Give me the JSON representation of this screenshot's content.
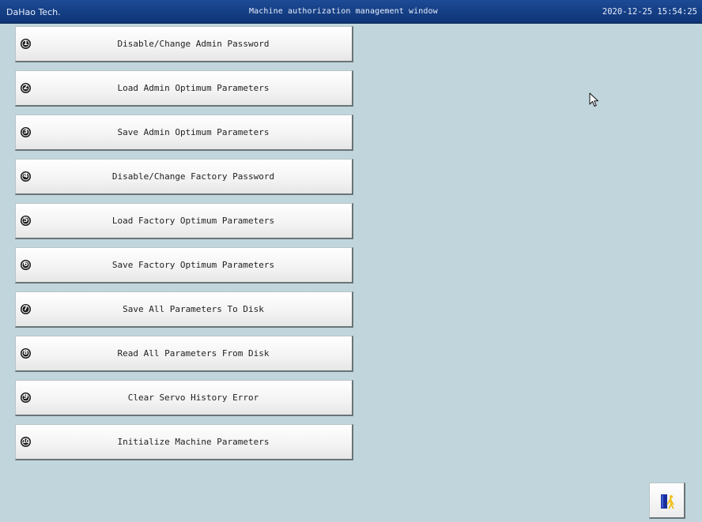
{
  "titlebar": {
    "company": "DaHao Tech.",
    "window_title": "Machine authorization management window",
    "datetime": "2020-12-25 15:54:25"
  },
  "menu": {
    "items": [
      {
        "number": "1",
        "label": "Disable/Change Admin Password"
      },
      {
        "number": "2",
        "label": "Load Admin Optimum Parameters"
      },
      {
        "number": "3",
        "label": "Save Admin Optimum Parameters"
      },
      {
        "number": "4",
        "label": "Disable/Change Factory Password"
      },
      {
        "number": "5",
        "label": "Load Factory Optimum Parameters"
      },
      {
        "number": "6",
        "label": "Save Factory Optimum Parameters"
      },
      {
        "number": "7",
        "label": "Save All Parameters To Disk"
      },
      {
        "number": "8",
        "label": "Read All Parameters From Disk"
      },
      {
        "number": "9",
        "label": "Clear Servo History Error"
      },
      {
        "number": "10",
        "label": "Initialize Machine Parameters"
      }
    ]
  },
  "icons": {
    "cursor": "mouse-pointer-icon",
    "exit": "exit-door-icon"
  },
  "colors": {
    "titlebar": "#0e3476",
    "background": "#c0d6dc",
    "button": "#f3f3f3",
    "exit_door": "#1a2f9c",
    "exit_figure": "#f0c020"
  }
}
